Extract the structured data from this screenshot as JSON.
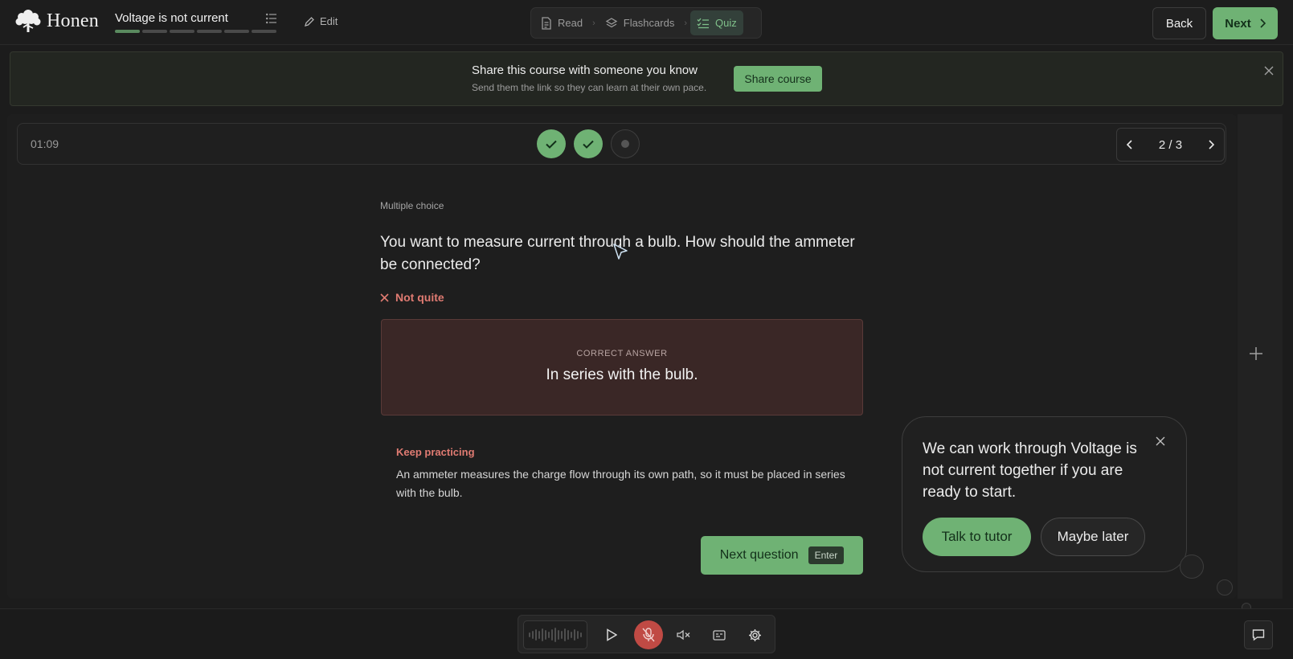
{
  "app": {
    "name": "Honen"
  },
  "lesson": {
    "title": "Voltage is not current",
    "segments_done": 1,
    "segments_total": 6
  },
  "header": {
    "edit_label": "Edit",
    "tabs": [
      {
        "label": "Read",
        "icon": "document-icon",
        "active": false
      },
      {
        "label": "Flashcards",
        "icon": "layers-icon",
        "active": false
      },
      {
        "label": "Quiz",
        "icon": "checklist-icon",
        "active": true
      }
    ],
    "back_label": "Back",
    "next_label": "Next"
  },
  "banner": {
    "title": "Share this course with someone you know",
    "subtitle": "Send them the link so they can learn at their own pace.",
    "button_label": "Share course"
  },
  "quiz": {
    "timer": "01:09",
    "question_states": [
      "correct",
      "correct",
      "current"
    ],
    "position": "2 / 3",
    "type_label": "Multiple choice",
    "question": "You want to measure current through a bulb. How should the ammeter be connected?",
    "verdict": "Not quite",
    "correct_answer_label": "CORRECT ANSWER",
    "correct_answer": "In series with the bulb.",
    "feedback_title": "Keep practicing",
    "feedback_body": "An ammeter measures the charge flow through its own path, so it must be placed in series with the bulb.",
    "next_button": "Next question",
    "next_shortcut": "Enter"
  },
  "tutor": {
    "message": "We can work through Voltage is not current together if you are ready to start.",
    "primary_label": "Talk to tutor",
    "secondary_label": "Maybe later"
  },
  "colors": {
    "accent": "#6fb274",
    "error": "#e07b72",
    "background": "#1c1c1c"
  }
}
